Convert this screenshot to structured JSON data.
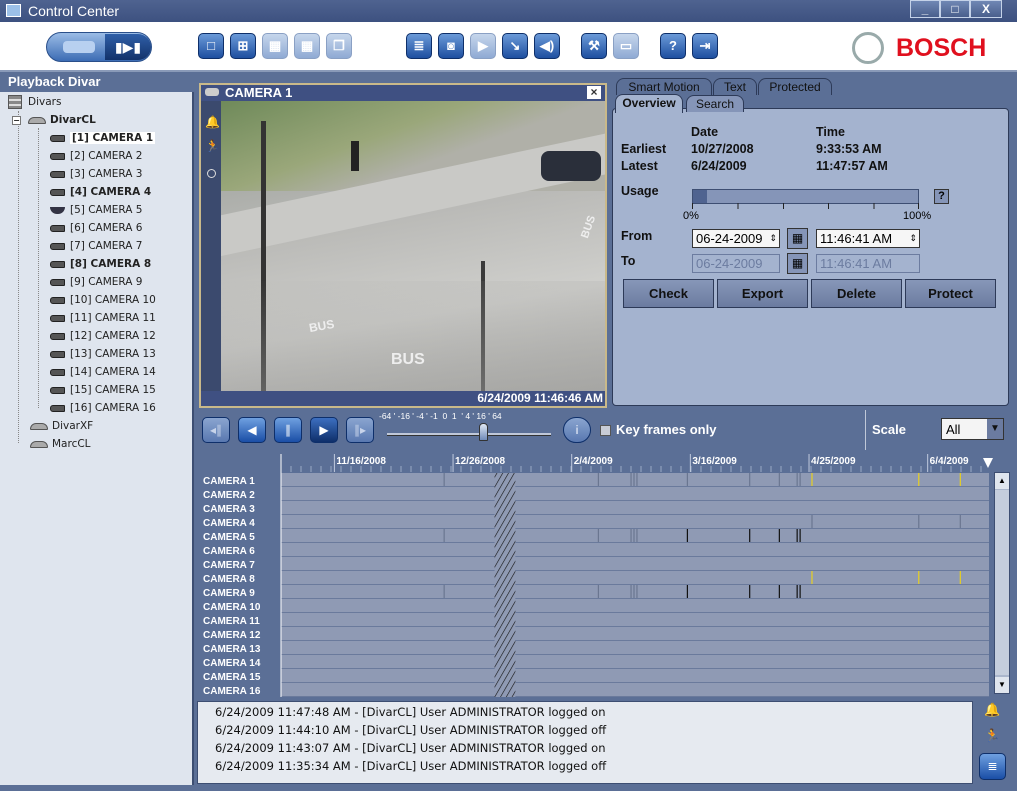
{
  "window": {
    "title": "Control Center",
    "minimize": "_",
    "maximize": "□",
    "close": "X"
  },
  "toolbar": {
    "mode_icons": [
      "live-mode-icon",
      "playback-mode-icon"
    ],
    "layout_icons": [
      "single-view-icon",
      "quad-view-icon",
      "grid-3x3-icon",
      "grid-4x4-icon",
      "cascade-icon"
    ],
    "action_icons": [
      "notes-icon",
      "snapshot-icon",
      "play-icon",
      "export-icon",
      "audio-icon"
    ],
    "tool_icons": [
      "wrench-icon",
      "monitor-icon"
    ],
    "help_icons": [
      "help-icon",
      "logout-icon"
    ],
    "brand": "BOSCH"
  },
  "sidebar": {
    "title": "Playback Divar",
    "root": "Divars",
    "divars": [
      {
        "label": "DivarCL",
        "expanded": true
      },
      {
        "label": "DivarXF"
      },
      {
        "label": "MarcCL"
      }
    ],
    "cameras": [
      {
        "label": "[1] CAMERA 1",
        "bold": true,
        "selected": true
      },
      {
        "label": "[2] CAMERA 2"
      },
      {
        "label": "[3] CAMERA 3"
      },
      {
        "label": "[4] CAMERA 4",
        "bold": true
      },
      {
        "label": "[5] CAMERA 5",
        "dome": true
      },
      {
        "label": "[6] CAMERA 6"
      },
      {
        "label": "[7] CAMERA 7"
      },
      {
        "label": "[8] CAMERA 8",
        "bold": true
      },
      {
        "label": "[9] CAMERA 9"
      },
      {
        "label": "[10] CAMERA 10"
      },
      {
        "label": "[11] CAMERA 11"
      },
      {
        "label": "[12] CAMERA 12"
      },
      {
        "label": "[13] CAMERA 13"
      },
      {
        "label": "[14] CAMERA 14"
      },
      {
        "label": "[15] CAMERA 15"
      },
      {
        "label": "[16] CAMERA 16"
      }
    ]
  },
  "video": {
    "title": "CAMERA 1",
    "timestamp": "6/24/2009 11:46:46 AM",
    "close": "×",
    "road_text": [
      "BUS",
      "BUS",
      "BUS"
    ]
  },
  "panel": {
    "tabs_back": [
      "Smart Motion",
      "Text",
      "Protected"
    ],
    "tabs_front": [
      "Overview",
      "Search"
    ],
    "date_header": "Date",
    "time_header": "Time",
    "earliest_label": "Earliest",
    "earliest_date": "10/27/2008",
    "earliest_time": "9:33:53 AM",
    "latest_label": "Latest",
    "latest_date": "6/24/2009",
    "latest_time": "11:47:57 AM",
    "usage_label": "Usage",
    "usage_percent": 6,
    "usage_min": "0%",
    "usage_max": "100%",
    "usage_help": "?",
    "from_label": "From",
    "from_date": "06-24-2009",
    "from_time": "11:46:41 AM",
    "to_label": "To",
    "to_date": "06-24-2009",
    "to_time": "11:46:41 AM",
    "buttons": [
      "Check",
      "Export",
      "Delete",
      "Protect"
    ]
  },
  "controls": {
    "speed_ticks": "-64 ' -16 ' -4 ' -1  0  1  ' 4 ' 16 ' 64",
    "speed": 1,
    "keyframes_label": "Key frames only",
    "keyframes_checked": false,
    "scale_label": "Scale",
    "scale_value": "All"
  },
  "timeline": {
    "start": "2008-10-29",
    "end": "2009-06-24",
    "date_labels": [
      "11/16/2008",
      "12/26/2008",
      "2/4/2009",
      "3/16/2009",
      "4/25/2009",
      "6/4/2009"
    ],
    "label_dates": [
      "2008-11-16",
      "2008-12-26",
      "2009-02-04",
      "2009-03-16",
      "2009-04-25",
      "2009-06-04"
    ],
    "gap": [
      "2009-01-09",
      "2009-01-16"
    ],
    "rows": [
      "CAMERA 1",
      "CAMERA 2",
      "CAMERA 3",
      "CAMERA 4",
      "CAMERA 5",
      "CAMERA 6",
      "CAMERA 7",
      "CAMERA 8",
      "CAMERA 9",
      "CAMERA 10",
      "CAMERA 11",
      "CAMERA 12",
      "CAMERA 13",
      "CAMERA 14",
      "CAMERA 15",
      "CAMERA 16"
    ],
    "colors": {
      "gray": "#6a7690",
      "black": "#111111",
      "yellow": "#e8d020"
    },
    "events": [
      {
        "row": 0,
        "dates": [
          "2008-12-23",
          "2009-02-13",
          "2009-02-24",
          "2009-02-25",
          "2009-02-26",
          "2009-03-15",
          "2009-04-05",
          "2009-04-15",
          "2009-04-21",
          "2009-04-22"
        ],
        "color": "gray"
      },
      {
        "row": 0,
        "dates": [
          "2009-04-26",
          "2009-06-01",
          "2009-06-15"
        ],
        "color": "yellow"
      },
      {
        "row": 3,
        "dates": [
          "2009-04-26",
          "2009-06-01",
          "2009-06-15"
        ],
        "color": "gray"
      },
      {
        "row": 4,
        "dates": [
          "2008-12-23",
          "2009-02-13",
          "2009-02-24",
          "2009-02-25",
          "2009-02-26"
        ],
        "color": "gray"
      },
      {
        "row": 4,
        "dates": [
          "2009-03-15",
          "2009-04-05",
          "2009-04-15",
          "2009-04-21",
          "2009-04-22"
        ],
        "color": "black"
      },
      {
        "row": 7,
        "dates": [
          "2009-04-26",
          "2009-06-01",
          "2009-06-15"
        ],
        "color": "yellow"
      },
      {
        "row": 8,
        "dates": [
          "2008-12-23",
          "2009-02-13",
          "2009-02-24",
          "2009-02-25",
          "2009-02-26"
        ],
        "color": "gray"
      },
      {
        "row": 8,
        "dates": [
          "2009-03-15",
          "2009-04-05",
          "2009-04-15",
          "2009-04-21",
          "2009-04-22"
        ],
        "color": "black"
      }
    ]
  },
  "log": [
    "6/24/2009 11:47:48 AM - [DivarCL] User ADMINISTRATOR logged on",
    "6/24/2009 11:44:10 AM - [DivarCL] User ADMINISTRATOR logged off",
    "6/24/2009 11:43:07 AM - [DivarCL] User ADMINISTRATOR logged on",
    "6/24/2009 11:35:34 AM - [DivarCL] User ADMINISTRATOR logged off"
  ]
}
